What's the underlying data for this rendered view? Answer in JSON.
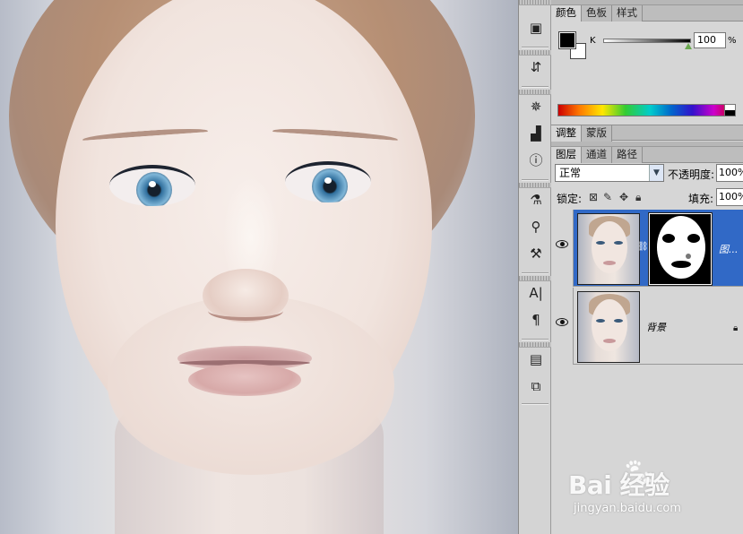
{
  "color_panel": {
    "tabs": [
      "颜色",
      "色板",
      "样式"
    ],
    "active_tab": 0,
    "channel_label": "K",
    "value": "100",
    "unit": "%",
    "slider_value": 100,
    "foreground_color": "#000000",
    "background_color": "#ffffff"
  },
  "adjust_panel": {
    "tabs": [
      "调整",
      "蒙版"
    ],
    "active_tab": 0
  },
  "layers_panel": {
    "tabs": [
      "图层",
      "通道",
      "路径"
    ],
    "active_tab": 0,
    "blend_mode": "正常",
    "opacity_label": "不透明度:",
    "opacity_value": "100%",
    "lock_label": "锁定:",
    "fill_label": "填充:",
    "fill_value": "100%",
    "layers": [
      {
        "name": "图...",
        "selected": true,
        "has_mask": true,
        "visible": true
      },
      {
        "name": "背景",
        "selected": false,
        "has_mask": false,
        "visible": true,
        "locked": true
      }
    ],
    "selection_color": "#3169c6"
  },
  "toolstrip": {
    "icons": [
      "layers-comp-icon",
      "history-icon",
      "navigator-icon",
      "histogram-icon",
      "info-icon",
      "brush-presets-icon",
      "clone-source-icon",
      "tool-presets-icon",
      "character-icon",
      "paragraph-icon",
      "notes-icon",
      "copy-icon"
    ]
  },
  "watermark": {
    "logo_text": "Bai  经验",
    "site": "jingyan.baidu.com"
  }
}
